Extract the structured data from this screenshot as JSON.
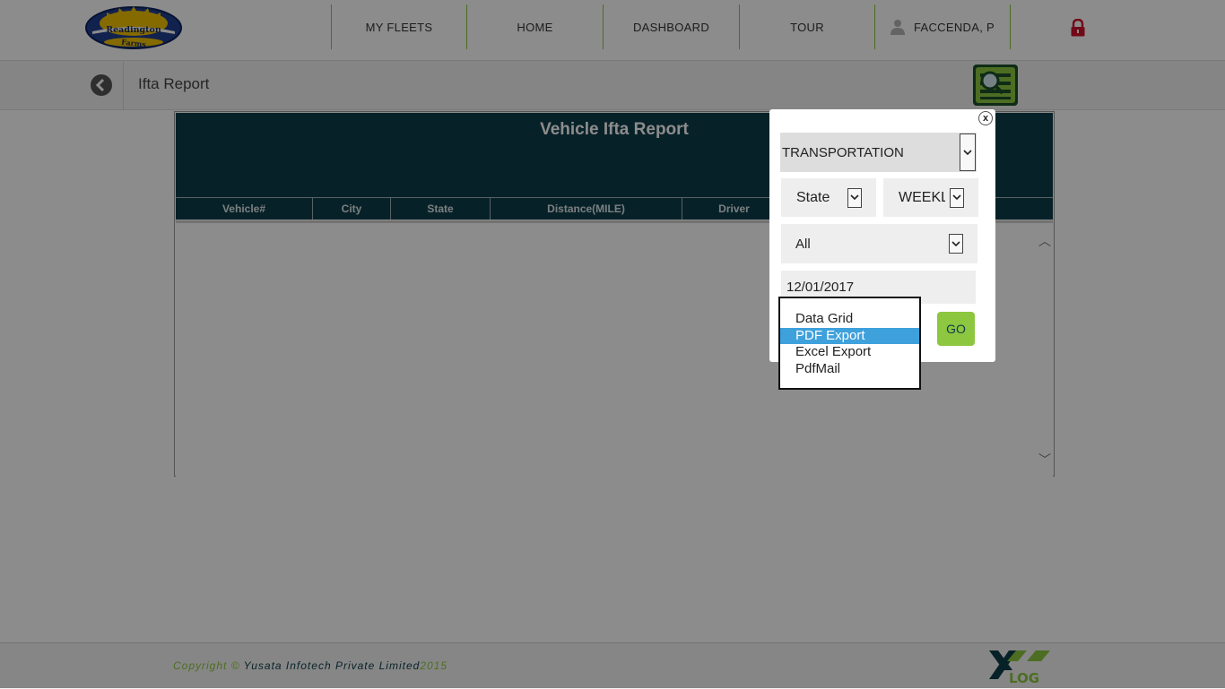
{
  "header": {
    "logo_text_top": "Readington",
    "logo_text_bottom": "Farms",
    "nav": [
      {
        "label": "MY FLEETS"
      },
      {
        "label": "HOME"
      },
      {
        "label": "DASHBOARD"
      },
      {
        "label": "TOUR"
      },
      {
        "label": "FACCENDA, P"
      }
    ],
    "icons": {
      "user": "user-icon",
      "lock": "lock-icon"
    }
  },
  "subheader": {
    "title": "Ifta Report",
    "back_icon": "back-arrow-icon",
    "search_icon": "search-report-icon"
  },
  "report": {
    "title": "Vehicle Ifta Report",
    "columns": [
      "Vehicle#",
      "City",
      "State",
      "Distance(MILE)",
      "Driver"
    ]
  },
  "filter_modal": {
    "close_label": "x",
    "group_select": "TRANSPORTATION",
    "type_select": "State",
    "period_select": "WEEKLY",
    "vehicle_select": "All",
    "date_value": "12/01/2017",
    "go_label": "GO",
    "output_options": [
      "Data Grid",
      "PDF Export",
      "Excel Export",
      "PdfMail"
    ],
    "selected_output": "PDF Export"
  },
  "footer": {
    "copyright_prefix": "Copyright ©",
    "company": "Yusata Infotech Private Limited",
    "year": "2015",
    "brand_text": "LOG"
  },
  "colors": {
    "accent_green": "#8dc63f",
    "header_dark": "#0e3c4a",
    "highlight_blue": "#3fa1dc",
    "lock_red": "#d0112b"
  }
}
